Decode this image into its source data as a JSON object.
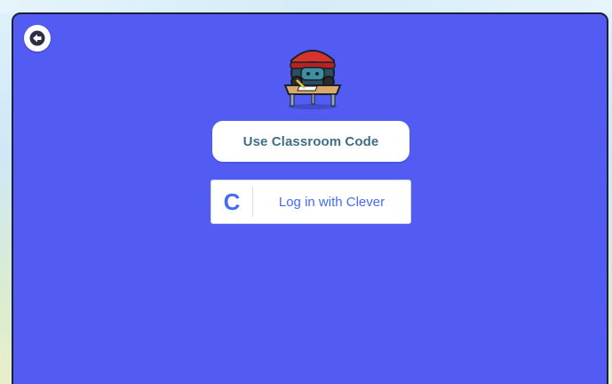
{
  "header": {
    "back_icon": "arrow-left-icon"
  },
  "mascot": {
    "icon": "student-robot-at-desk-icon"
  },
  "login": {
    "classroom_code_label": "Use Classroom Code",
    "clever_logo_letter": "C",
    "clever_label": "Log in with Clever"
  },
  "colors": {
    "panel_background": "#535cf2",
    "clever_blue": "#436cf2",
    "classroom_text": "#3e6f86",
    "mascot_hat": "#d8322f",
    "mascot_body": "#2f4d5e",
    "desk_wood": "#d9a86a"
  }
}
